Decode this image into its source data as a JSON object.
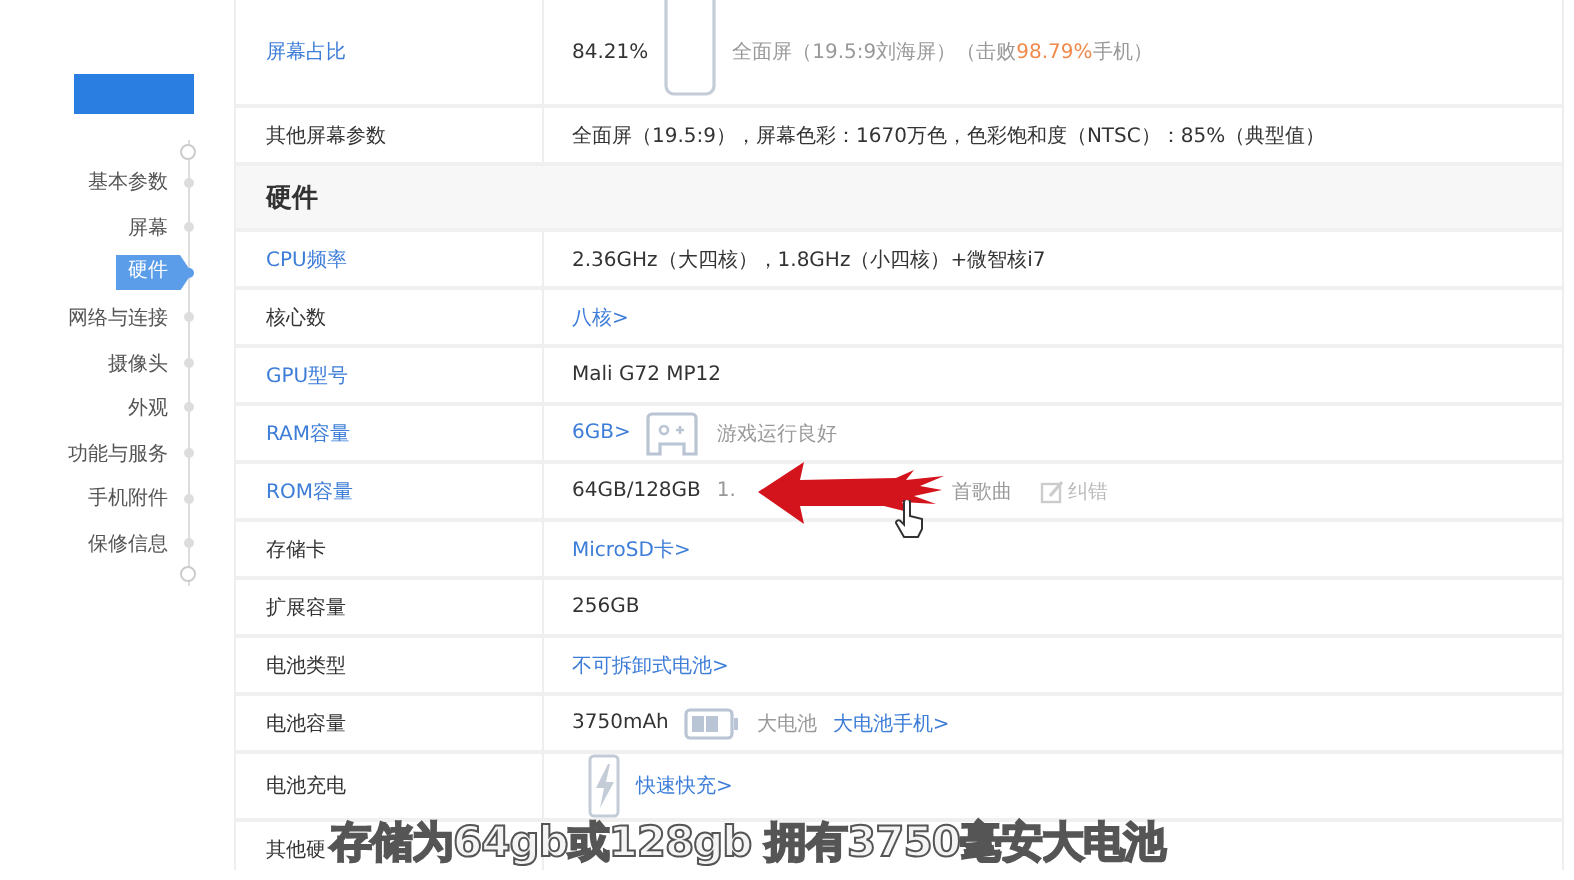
{
  "sidebar": {
    "items": [
      {
        "label": "基本参数",
        "selected": false
      },
      {
        "label": "屏幕",
        "selected": false
      },
      {
        "label": "硬件",
        "selected": true
      },
      {
        "label": "网络与连接",
        "selected": false
      },
      {
        "label": "摄像头",
        "selected": false
      },
      {
        "label": "外观",
        "selected": false
      },
      {
        "label": "功能与服务",
        "selected": false
      },
      {
        "label": "手机附件",
        "selected": false
      },
      {
        "label": "保修信息",
        "selected": false
      }
    ]
  },
  "spec_table": {
    "rows": [
      {
        "kind": "row",
        "label": "屏幕占比",
        "link": true,
        "values": [
          {
            "kind": "text",
            "text": "84.21%"
          },
          {
            "kind": "phone"
          },
          {
            "kind": "note",
            "text": "全面屏（19.5:9刘海屏）（击败",
            "highlight": "98.79%",
            "after": "手机）"
          }
        ]
      },
      {
        "kind": "row",
        "label": "其他屏幕参数",
        "link": false,
        "values": [
          {
            "kind": "text",
            "text": "全面屏（19.5:9），屏幕色彩：1670万色，色彩饱和度（NTSC）：85%（典型值）"
          }
        ]
      },
      {
        "kind": "section",
        "label": "硬件"
      },
      {
        "kind": "row",
        "label": "CPU频率",
        "link": true,
        "values": [
          {
            "kind": "text",
            "text": "2.36GHz（大四核），1.8GHz（小四核）+微智核i7"
          }
        ]
      },
      {
        "kind": "row",
        "label": "核心数",
        "link": false,
        "values": [
          {
            "kind": "link",
            "text": "八核>"
          }
        ]
      },
      {
        "kind": "row",
        "label": "GPU型号",
        "link": true,
        "values": [
          {
            "kind": "text",
            "text": "Mali G72 MP12"
          }
        ]
      },
      {
        "kind": "row",
        "label": "RAM容量",
        "link": true,
        "values": [
          {
            "kind": "link",
            "text": "6GB>"
          },
          {
            "kind": "gamepad"
          },
          {
            "kind": "note",
            "text": "游戏运行良好"
          }
        ]
      },
      {
        "kind": "row",
        "label": "ROM容量",
        "link": true,
        "values": [
          {
            "kind": "text",
            "text": "64GB/128GB"
          },
          {
            "kind": "note",
            "text": "1."
          },
          {
            "kind": "note",
            "text": "首歌曲"
          },
          {
            "kind": "edit",
            "text": "纠错"
          }
        ]
      },
      {
        "kind": "row",
        "label": "存储卡",
        "link": false,
        "values": [
          {
            "kind": "link",
            "text": "MicroSD卡>"
          }
        ]
      },
      {
        "kind": "row",
        "label": "扩展容量",
        "link": false,
        "values": [
          {
            "kind": "text",
            "text": "256GB"
          }
        ]
      },
      {
        "kind": "row",
        "label": "电池类型",
        "link": false,
        "values": [
          {
            "kind": "link",
            "text": "不可拆卸式电池>"
          }
        ]
      },
      {
        "kind": "row",
        "label": "电池容量",
        "link": false,
        "values": [
          {
            "kind": "text",
            "text": "3750mAh"
          },
          {
            "kind": "battery"
          },
          {
            "kind": "note",
            "text": "大电池"
          },
          {
            "kind": "link",
            "text": "大电池手机>"
          }
        ]
      },
      {
        "kind": "row",
        "label": "电池充电",
        "link": false,
        "values": [
          {
            "kind": "bolt"
          },
          {
            "kind": "link",
            "text": "快速快充>"
          }
        ]
      },
      {
        "kind": "row",
        "label": "其他硬",
        "link": false,
        "values": []
      }
    ]
  },
  "subtitle": "存储为64gb或128gb 拥有3750毫安大电池"
}
